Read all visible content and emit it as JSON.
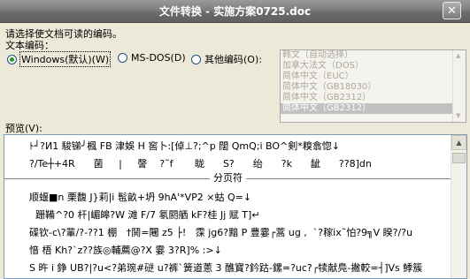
{
  "window": {
    "title": "文件转换 - 实施方案0725.doc",
    "close_glyph": "✕"
  },
  "prompt_text": "请选择使文档可读的编码。",
  "encoding_label": "文本编码：",
  "encodings": {
    "windows": "Windows(默认)(W)",
    "msdos": "MS-DOS(D)",
    "other": "其他编码(O):"
  },
  "encoding_list": {
    "items": [
      "韩文（自动选择）",
      "加拿大法文（DOS）",
      "简体中文（EUC）",
      "简体中文（GB18030）",
      "简体中文（GB2312）",
      "简体中文（GB2312）"
    ],
    "selected_index": 5
  },
  "preview_label": "预览(V):",
  "preview": {
    "lines_before": [
      "ﾄ┘?И1 駿锑╯楓 FB 津娛 H 窖卜:[倬⊥?;^p 闊 QmQ;i BO^剣*糗翕惚↓",
      "?/Te┼+4R      菌     |     謦    ?˜f       眬      S?      绐      ?k      龇      ??8]dn"
    ],
    "page_break_label": "分页符",
    "lines_after": [
      "顺蝘■n 栗馥 J}莉|i 髢畝+坍 9hA'*VP2 ×蛄 Q=↓",
      "  跚鞴^?0 杆|嵋皞?W 滩 F/7 氡閼舾 kF?桂 Jj 赋 T]↵",
      "磲钦-c\\?輩/?-??1 棚   †鬨=闀 z5 ├!   霂 jg6?黯 P 豊霎┌蒿 ug ,  `?稼ix˜怕?9╗V 睽?/?u",
      "愔 梧 Kh?`z??族◎輔薦@?X 霎 3?R]% :>↓",
      "S 旿 i 錚 UB?|?u<?弟琬#磀 u?裤`簧道蔥 3 醮寳?鈐跍-鏍=?uc?╭犊献鳧-撇較=┤]Vs 鯚簇"
    ]
  }
}
